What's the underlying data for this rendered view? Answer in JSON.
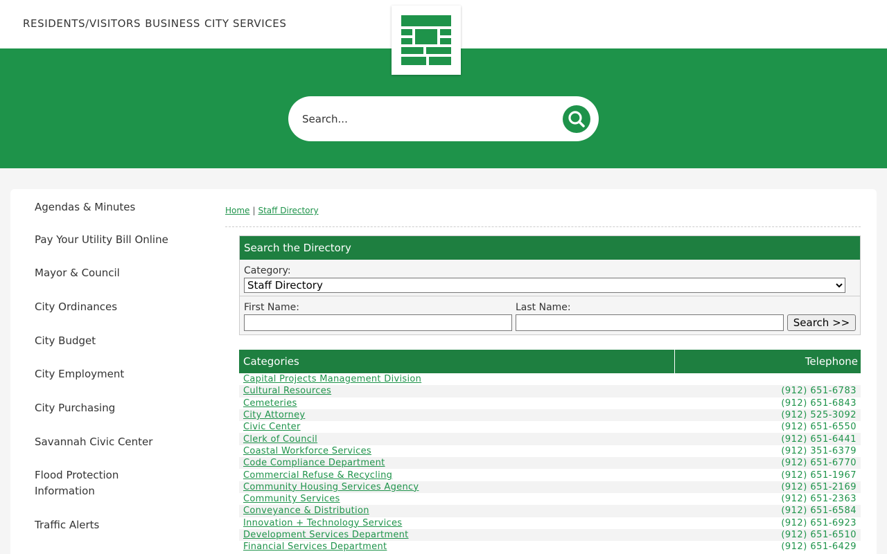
{
  "top_nav": [
    "RESIDENTS/VISITORS",
    "BUSINESS",
    "CITY SERVICES"
  ],
  "search": {
    "placeholder": "Search..."
  },
  "sidebar": {
    "items": [
      "Agendas & Minutes",
      "Pay Your Utility Bill Online",
      "Mayor & Council",
      "City Ordinances",
      "City Budget",
      "City Employment",
      "City Purchasing",
      "Savannah Civic Center",
      "Flood Protection Information",
      "Traffic Alerts"
    ]
  },
  "breadcrumb": {
    "home": "Home",
    "current": "Staff Directory"
  },
  "directory_search": {
    "title": "Search the Directory",
    "category_label": "Category:",
    "category_value": "Staff Directory",
    "first_name_label": "First Name:",
    "last_name_label": "Last Name:",
    "search_button": "Search >>"
  },
  "table": {
    "headers": {
      "categories": "Categories",
      "telephone": "Telephone"
    },
    "rows": [
      {
        "name": "Capital Projects Management Division",
        "phone": ""
      },
      {
        "name": "Cultural Resources",
        "phone": "(912) 651-6783"
      },
      {
        "name": "Cemeteries",
        "phone": "(912) 651-6843"
      },
      {
        "name": "City Attorney",
        "phone": "(912) 525-3092"
      },
      {
        "name": "Civic Center",
        "phone": "(912) 651-6550"
      },
      {
        "name": "Clerk of Council",
        "phone": "(912) 651-6441"
      },
      {
        "name": "Coastal Workforce Services",
        "phone": "(912) 351-6379"
      },
      {
        "name": "Code Compliance Department",
        "phone": "(912) 651-6770"
      },
      {
        "name": "Commercial Refuse & Recycling",
        "phone": "(912) 651-1967"
      },
      {
        "name": "Community Housing Services Agency",
        "phone": "(912) 651-2169"
      },
      {
        "name": "Community Services",
        "phone": "(912) 651-2363"
      },
      {
        "name": "Conveyance & Distribution",
        "phone": "(912) 651-6584"
      },
      {
        "name": "Innovation + Technology Services",
        "phone": "(912) 651-6923"
      },
      {
        "name": "Development Services Department",
        "phone": "(912) 651-6510"
      },
      {
        "name": "Financial Services Department",
        "phone": "(912) 651-6429"
      }
    ]
  },
  "colors": {
    "brand_green": "#1e934a",
    "header_green": "#1e7f40"
  }
}
